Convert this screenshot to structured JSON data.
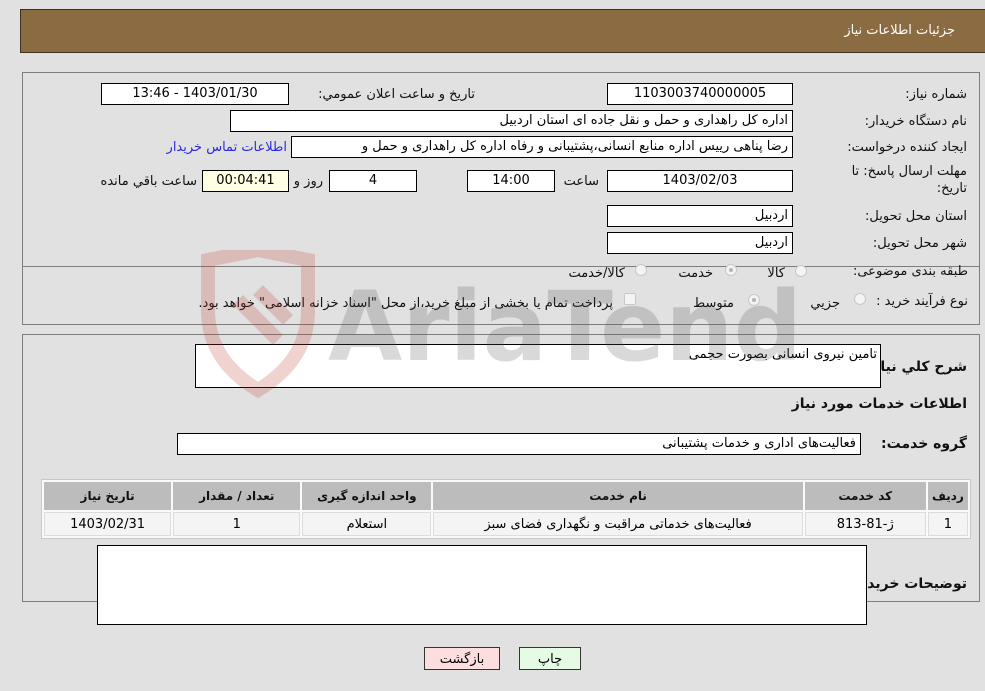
{
  "header": {
    "title": "جزئیات اطلاعات نیاز"
  },
  "form": {
    "need_number": {
      "label": "شماره نیاز:",
      "value": "1103003740000005"
    },
    "announce_datetime": {
      "label": "تاریخ و ساعت اعلان عمومي:",
      "value": "1403/01/30 - 13:46"
    },
    "buyer_org": {
      "label": "نام دستگاه خريدار:",
      "value": "اداره کل راهداری و حمل و نقل جاده ای استان اردبیل"
    },
    "creator": {
      "label": "ایجاد کننده درخواست:",
      "value": "رضا پناهی رییس اداره منابع انسانی،پشتیبانی و رفاه اداره کل راهداری و حمل و"
    },
    "buyer_contact_link": "اطلاعات تماس خریدار",
    "deadline": {
      "label_line1": "مهلت ارسال پاسخ: تا",
      "label_line2": "تاریخ:",
      "date": "1403/02/03",
      "time_label": "ساعت",
      "time": "14:00",
      "days": "4",
      "days_label": "روز و",
      "remaining": "00:04:41",
      "remaining_label": "ساعت باقي مانده"
    },
    "delivery_province": {
      "label": "استان محل تحویل:",
      "value": "اردبیل"
    },
    "delivery_city": {
      "label": "شهر محل تحویل:",
      "value": "اردبیل"
    },
    "category": {
      "label": "طبقه بندی موضوعی:",
      "options": [
        "کالا",
        "خدمت",
        "کالا/خدمت"
      ],
      "selected": "خدمت"
    },
    "purchase_type": {
      "label": "نوع فرآیند خرید :",
      "options": [
        "جزیي",
        "متوسط"
      ],
      "selected": "متوسط",
      "treasury_note": "پرداخت تمام یا بخشی از مبلغ خرید،از محل \"اسناد خزانه اسلامی\" خواهد بود.",
      "treasury_checked": false
    }
  },
  "details": {
    "summary_label": "شرح كلي نياز:",
    "summary_value": "تامین نیروی انسانی بصورت حجمی",
    "services_heading": "اطلاعات خدمات مورد نياز",
    "service_group_label": "گروه خدمت:",
    "service_group_value": "فعالیت‌های اداری و خدمات پشتیبانی",
    "table": {
      "headers": [
        "ردیف",
        "کد خدمت",
        "نام خدمت",
        "واحد اندازه گیری",
        "تعداد / مقدار",
        "تاریخ نیاز"
      ],
      "rows": [
        [
          "1",
          "ژ-81-813",
          "فعالیت‌های خدماتی مراقبت و نگهداری فضای سبز",
          "استعلام",
          "1",
          "1403/02/31"
        ]
      ]
    },
    "buyer_notes_label": "توضیحات خریدار:",
    "buyer_notes_value": ""
  },
  "buttons": {
    "print": "چاپ",
    "back": "بازگشت"
  },
  "watermark": {
    "text": "AriaTender.neT"
  }
}
